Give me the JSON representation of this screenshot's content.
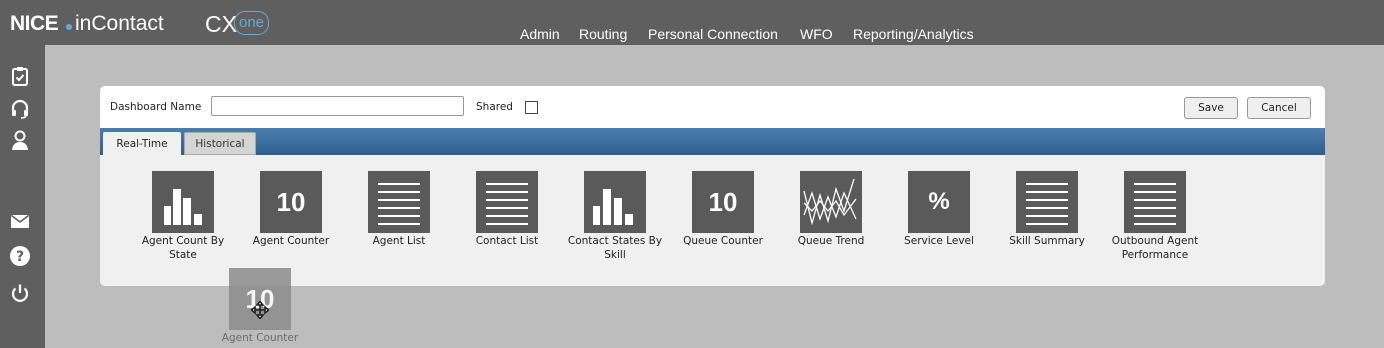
{
  "brand": {
    "nice": "NICE",
    "incontact": "inContact",
    "cx": "CX",
    "one": "one"
  },
  "nav": [
    "Admin",
    "Routing",
    "Personal Connection",
    "WFO",
    "Reporting/Analytics"
  ],
  "sidebar_icons": [
    "clipboard-check-icon",
    "headset-icon",
    "agent-icon",
    "mail-icon",
    "help-icon",
    "power-icon"
  ],
  "form": {
    "dashboard_name_label": "Dashboard Name",
    "dashboard_name_value": "",
    "shared_label": "Shared",
    "shared_checked": false,
    "save_label": "Save",
    "cancel_label": "Cancel"
  },
  "tabs": {
    "realtime": "Real-Time",
    "historical": "Historical"
  },
  "widgets": [
    {
      "icon": "bar-chart-icon",
      "label": "Agent Count By State"
    },
    {
      "icon": "number-icon",
      "icon_text": "10",
      "label": "Agent Counter"
    },
    {
      "icon": "list-icon",
      "label": "Agent List"
    },
    {
      "icon": "list-icon",
      "label": "Contact List"
    },
    {
      "icon": "bar-chart-icon",
      "label": "Contact States By Skill"
    },
    {
      "icon": "number-icon",
      "icon_text": "10",
      "label": "Queue Counter"
    },
    {
      "icon": "trend-icon",
      "label": "Queue Trend"
    },
    {
      "icon": "percent-icon",
      "icon_text": "%",
      "label": "Service Level"
    },
    {
      "icon": "list-icon",
      "label": "Skill Summary"
    },
    {
      "icon": "list-icon",
      "label": "Outbound Agent Performance"
    }
  ],
  "drag_ghost": {
    "icon_text": "10",
    "label": "Agent Counter"
  },
  "colors": {
    "topbar": "#5f5f5f",
    "background": "#bdbdbd",
    "tabbar": "#3d6c99",
    "widget_icon": "#5a5a5a"
  }
}
